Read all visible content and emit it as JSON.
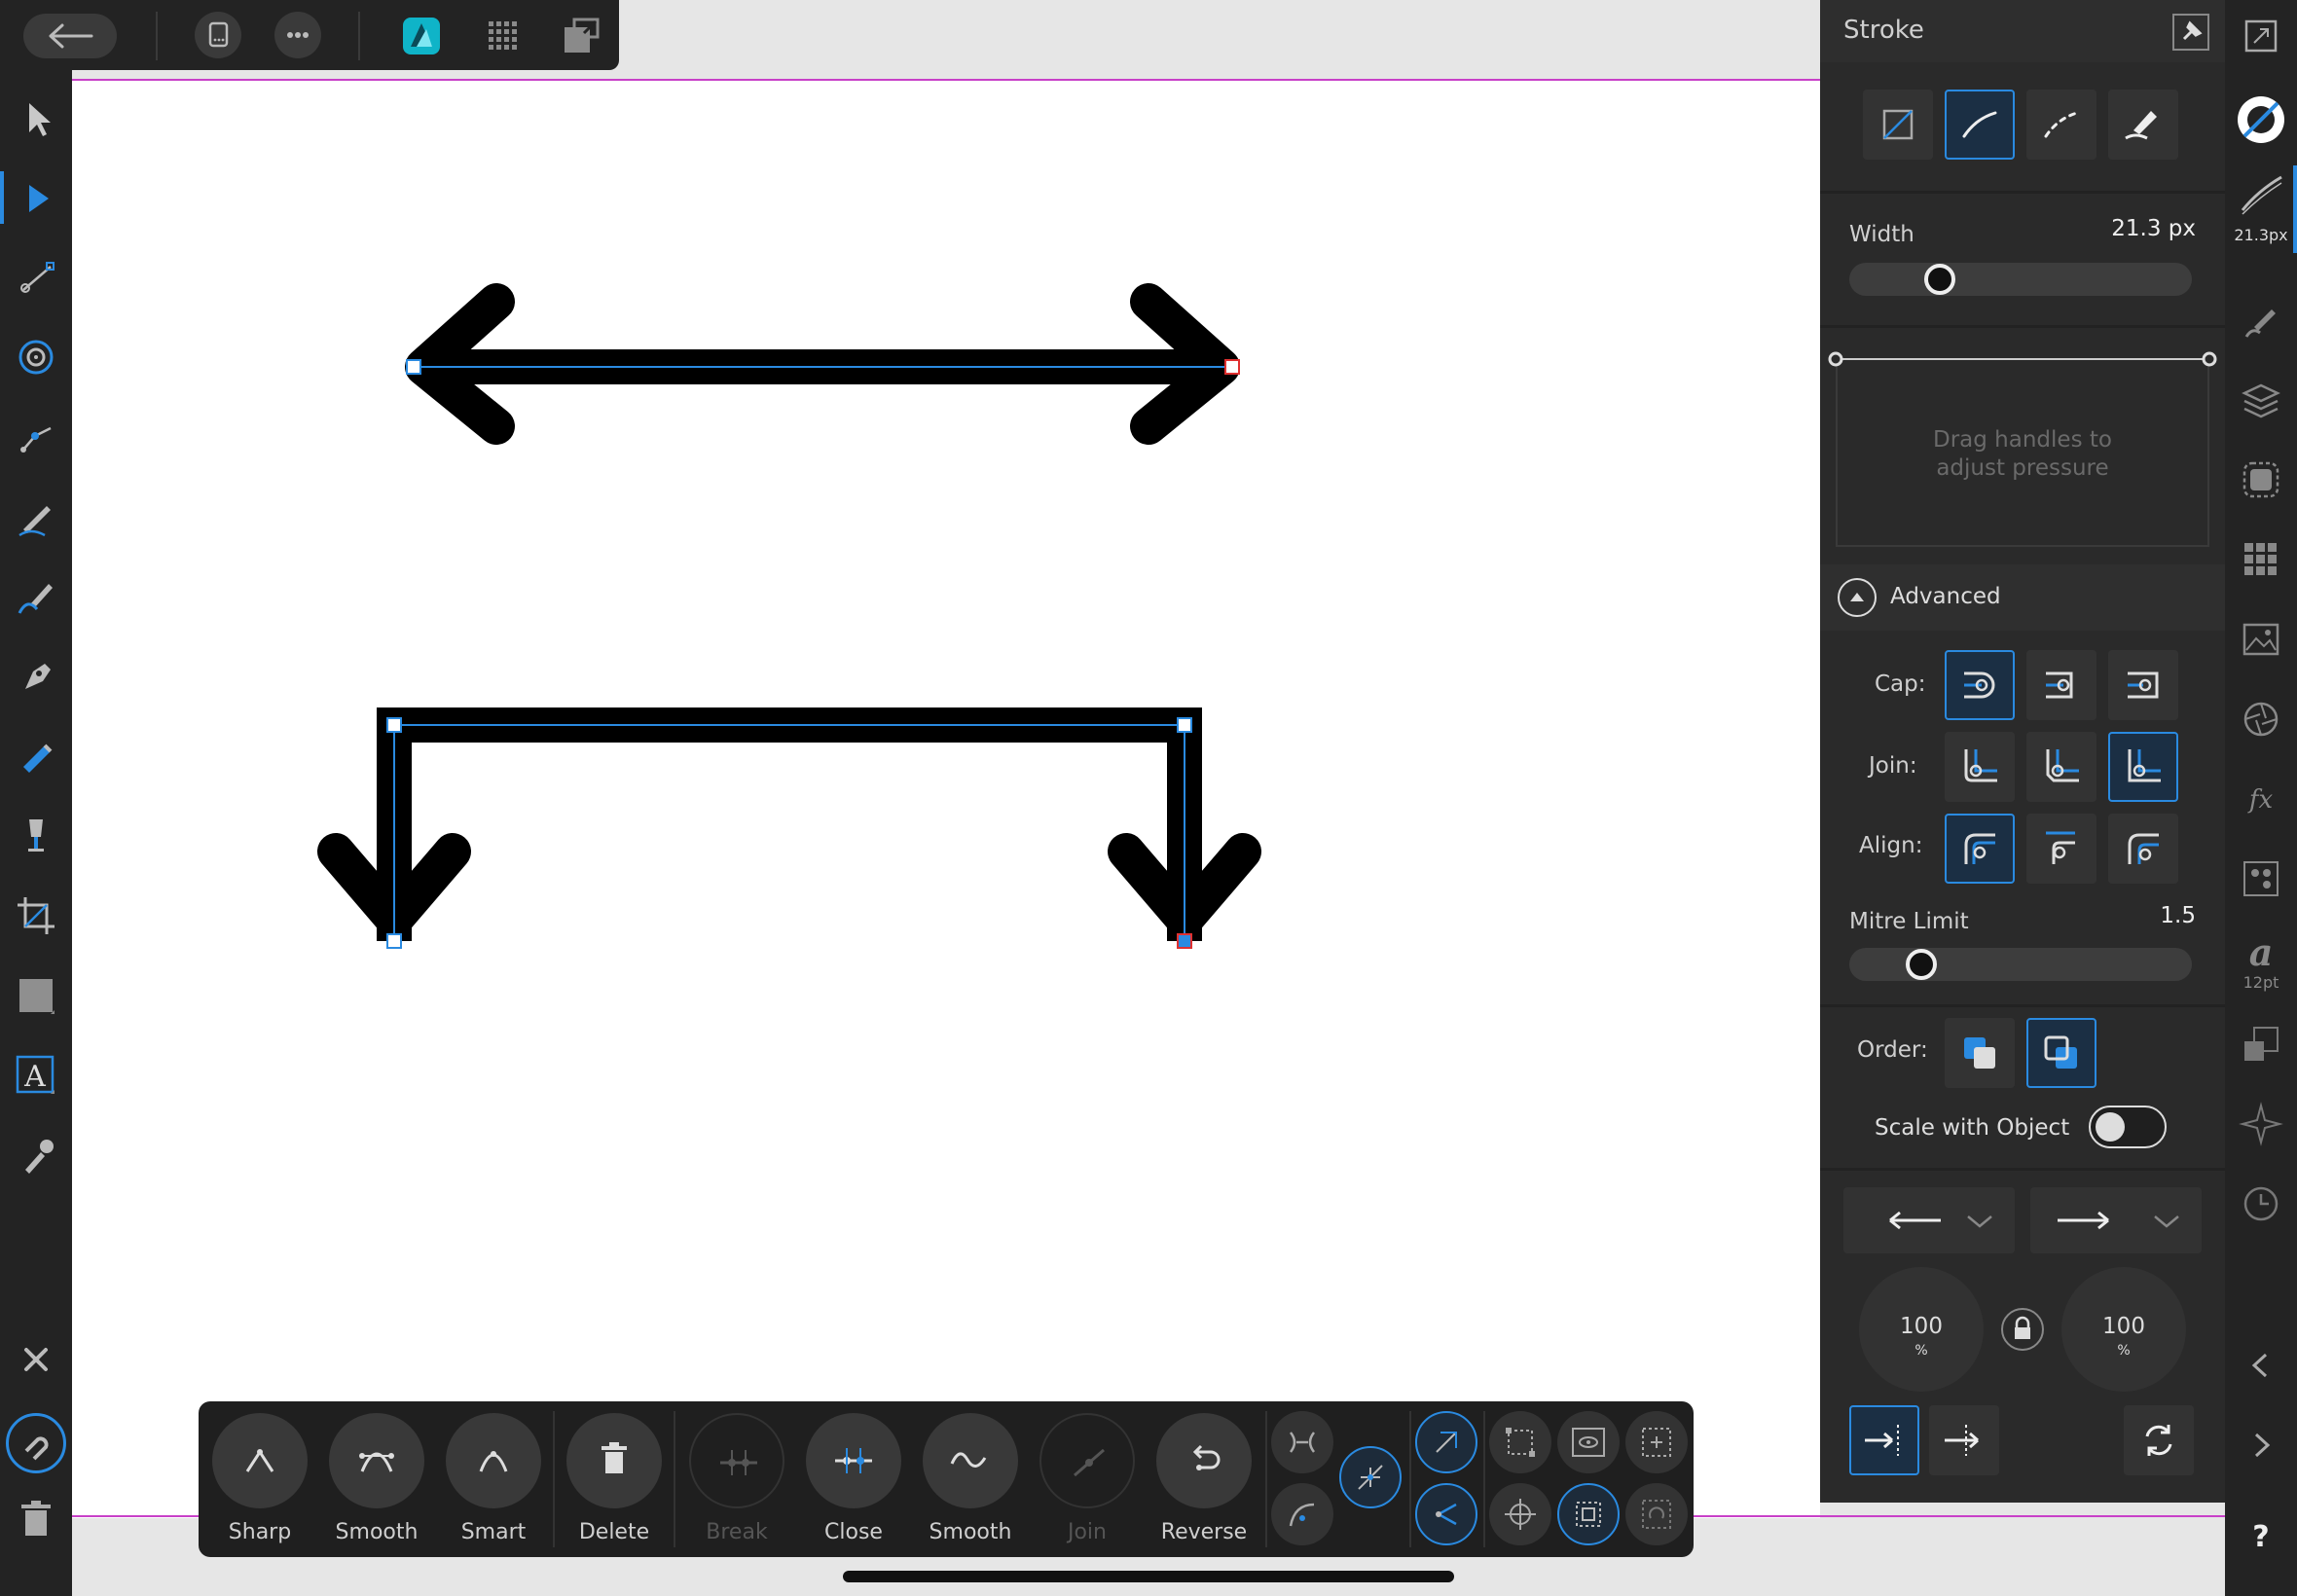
{
  "stroke_panel": {
    "title": "Stroke",
    "width_label": "Width",
    "width_value": "21.3 px",
    "width_fraction": 0.24,
    "pressure_hint_line1": "Drag handles to",
    "pressure_hint_line2": "adjust pressure",
    "advanced_label": "Advanced",
    "cap_label": "Cap:",
    "join_label": "Join:",
    "align_label": "Align:",
    "mitre_label": "Mitre Limit",
    "mitre_value": "1.5",
    "mitre_fraction": 0.18,
    "order_label": "Order:",
    "scale_label": "Scale with Object",
    "start_scale": "100",
    "end_scale": "100",
    "percent": "%"
  },
  "studio_strip": {
    "stroke_width": "21.3px",
    "font_size": "12pt",
    "help": "?"
  },
  "context_toolbar": {
    "buttons": [
      "Sharp",
      "Smooth",
      "Smart",
      "Delete",
      "Break",
      "Close",
      "Smooth",
      "Join",
      "Reverse"
    ]
  },
  "colors": {
    "accent": "#2a8ae0",
    "panel": "#2a2a2a",
    "toolbar": "#232323",
    "guide": "#c840c8"
  }
}
